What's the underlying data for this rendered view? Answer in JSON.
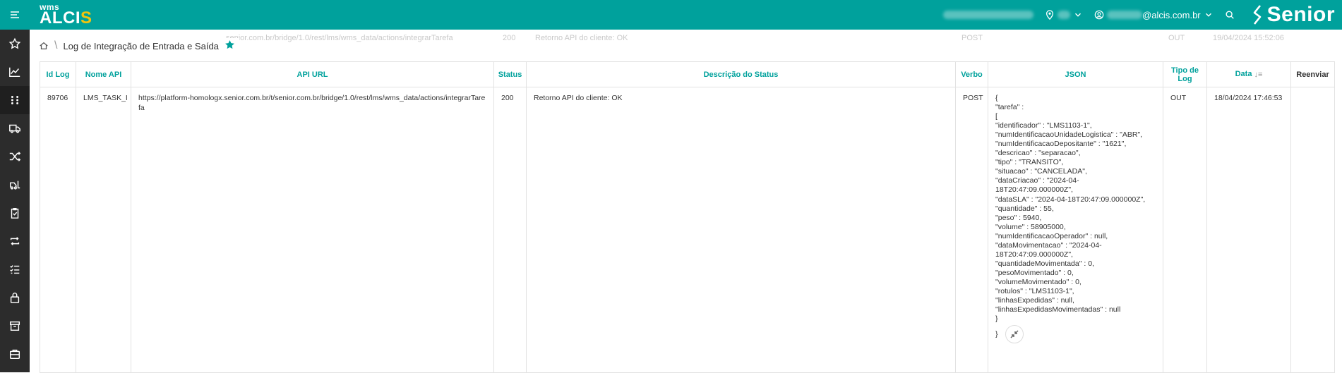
{
  "topbar": {
    "logo_small": "wms",
    "logo_big_main": "ALCI",
    "logo_big_accent": "S",
    "user_email_suffix": "@alcis.com.br",
    "brand": "Senior"
  },
  "breadcrumb": {
    "title": "Log de Integração de Entrada e Saída"
  },
  "ghost_row": {
    "url": "senior.com.br/bridge/1.0/rest/lms/wms_data/actions/integrarTarefa",
    "status": "200",
    "desc": "Retorno API do cliente: OK",
    "verbo": "POST",
    "tipo": "OUT",
    "data": "19/04/2024 15:52:06"
  },
  "table": {
    "headers": {
      "id_log": "Id Log",
      "nome_api": "Nome API",
      "api_url": "API URL",
      "status": "Status",
      "descricao": "Descrição do Status",
      "verbo": "Verbo",
      "json": "JSON",
      "tipo_log": "Tipo de Log",
      "data": "Data",
      "reenviar": "Reenviar"
    },
    "row": {
      "id_log": "89706",
      "nome_api": "LMS_TASK_I",
      "api_url": "https://platform-homologx.senior.com.br/t/senior.com.br/bridge/1.0/rest/lms/wms_data/actions/integrarTarefa",
      "status": "200",
      "descricao": "Retorno API do cliente: OK",
      "verbo": "POST",
      "tipo_log": "OUT",
      "data": "18/04/2024 17:46:53",
      "json_lines": [
        "{",
        "\"tarefa\" :",
        "[",
        "\"identificador\" : \"LMS1103-1\",",
        "\"numIdentificacaoUnidadeLogistica\" : \"ABR\",",
        "\"numIdentificacaoDepositante\" : \"1621\",",
        "\"descricao\" : \"separacao\",",
        "\"tipo\" : \"TRANSITO\",",
        "\"situacao\" : \"CANCELADA\",",
        "\"dataCriacao\" : \"2024-04-",
        "18T20:47:09.000000Z\",",
        "\"dataSLA\" : \"2024-04-18T20:47:09.000000Z\",",
        "\"quantidade\" : 55,",
        "\"peso\" : 5940,",
        "\"volume\" : 58905000,",
        "\"numIdentificacaoOperador\" : null,",
        "\"dataMovimentacao\" : \"2024-04-",
        "18T20:47:09.000000Z\",",
        "\"quantidadeMovimentada\" : 0,",
        "\"pesoMovimentado\" : 0,",
        "\"volumeMovimentado\" : 0,",
        "\"rotulos\" : \"LMS1103-1\",",
        "\"linhasExpedidas\" : null,",
        "\"linhasExpedidasMovimentadas\" : null",
        "}"
      ],
      "json_close": "}"
    }
  },
  "sidebar": {
    "items": [
      {
        "icon": "star-icon",
        "active": false
      },
      {
        "icon": "chart-line-icon",
        "active": false
      },
      {
        "icon": "grid-dots-icon",
        "active": true
      },
      {
        "icon": "truck-icon",
        "active": false
      },
      {
        "icon": "shuffle-icon",
        "active": false
      },
      {
        "icon": "forklift-icon",
        "active": false
      },
      {
        "icon": "clipboard-check-icon",
        "active": false
      },
      {
        "icon": "repeat-icon",
        "active": false
      },
      {
        "icon": "checklist-icon",
        "active": false
      },
      {
        "icon": "lock-icon",
        "active": false
      },
      {
        "icon": "archive-icon",
        "active": false
      },
      {
        "icon": "briefcase-icon",
        "active": false
      }
    ]
  },
  "colors": {
    "accent": "#00a19c",
    "sidebar_bg": "#2c2c2c",
    "logo_accent": "#f1c40f"
  }
}
